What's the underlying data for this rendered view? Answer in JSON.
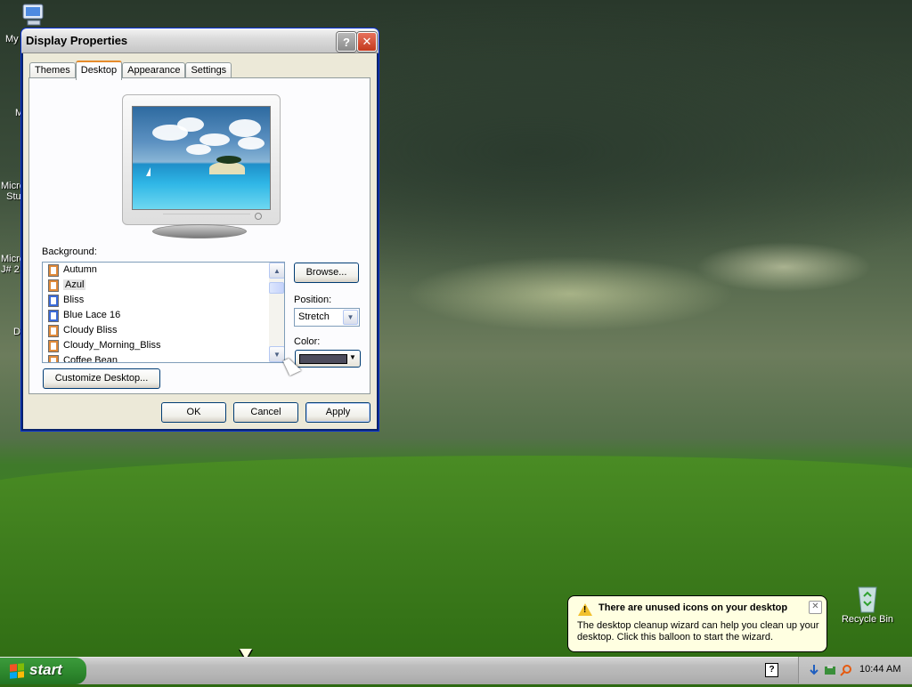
{
  "desktop": {
    "icons_partial": [
      "My",
      "M",
      "Micro\nStu",
      "Micro\nJ# 2",
      "D"
    ],
    "recycle_bin_label": "Recycle Bin"
  },
  "dialog": {
    "title": "Display Properties",
    "help_glyph": "?",
    "close_glyph": "✕",
    "tabs": [
      {
        "label": "Themes",
        "active": false
      },
      {
        "label": "Desktop",
        "active": true
      },
      {
        "label": "Appearance",
        "active": false
      },
      {
        "label": "Settings",
        "active": false
      }
    ],
    "background_label": "Background:",
    "background_items": [
      {
        "label": "Autumn",
        "selected": false,
        "icon": "image-file-icon"
      },
      {
        "label": "Azul",
        "selected": true,
        "icon": "image-file-icon"
      },
      {
        "label": "Bliss",
        "selected": false,
        "icon": "bmp-file-icon"
      },
      {
        "label": "Blue Lace 16",
        "selected": false,
        "icon": "bmp-file-icon"
      },
      {
        "label": "Cloudy Bliss",
        "selected": false,
        "icon": "image-file-icon"
      },
      {
        "label": "Cloudy_Morning_Bliss",
        "selected": false,
        "icon": "image-file-icon"
      },
      {
        "label": "Coffee Bean",
        "selected": false,
        "icon": "image-file-icon"
      }
    ],
    "browse_label": "Browse...",
    "position_label": "Position:",
    "position_value": "Stretch",
    "color_label": "Color:",
    "color_value": "#4c4c5c",
    "customize_label": "Customize Desktop...",
    "ok_label": "OK",
    "cancel_label": "Cancel",
    "apply_label": "Apply"
  },
  "taskbar": {
    "start_label": "start",
    "clock": "10:44 AM",
    "help_glyph": "?"
  },
  "balloon": {
    "title": "There are unused icons on your desktop",
    "text": "The desktop cleanup wizard can help you clean up your desktop. Click this balloon to start the wizard.",
    "close_glyph": "✕",
    "warn_glyph": "!"
  }
}
